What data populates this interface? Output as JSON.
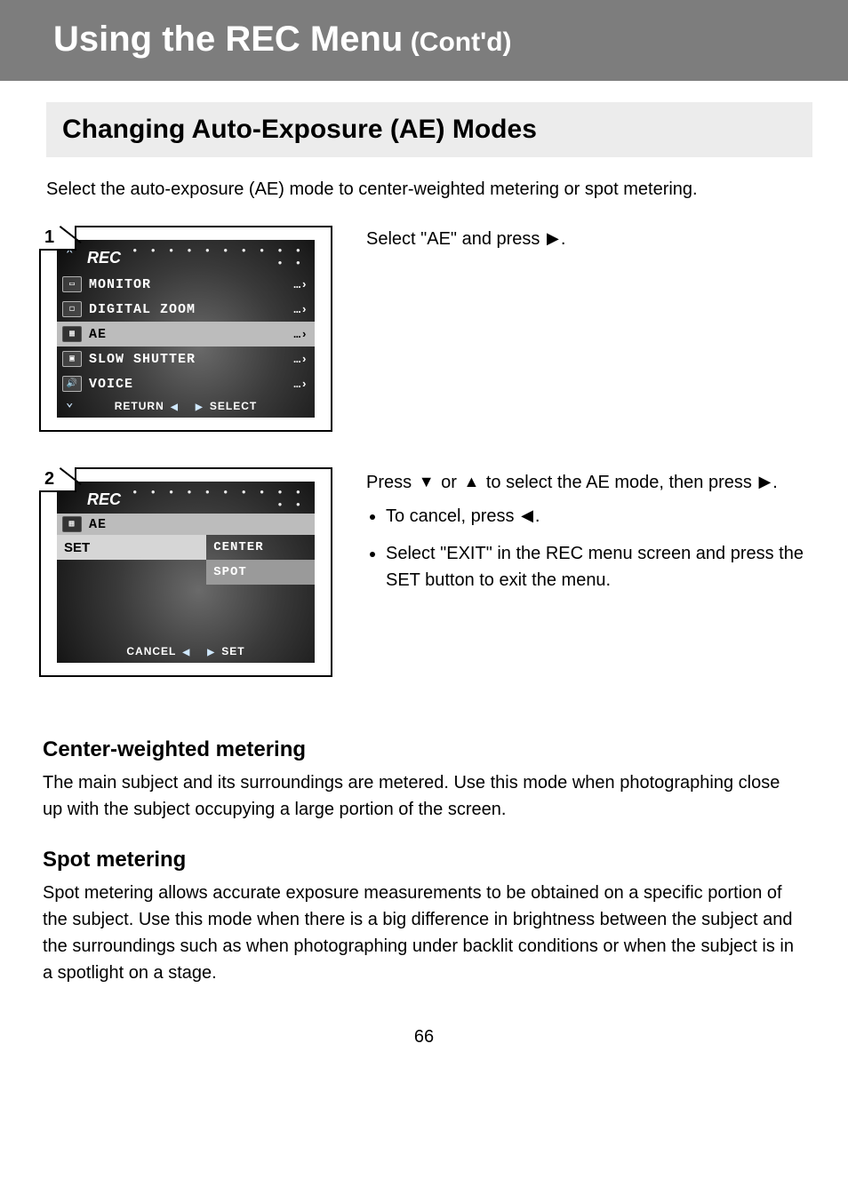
{
  "banner": {
    "title_main": "Using the REC Menu",
    "title_sub": "(Cont'd)"
  },
  "section_heading": "Changing Auto-Exposure (AE) Modes",
  "intro": "Select the auto-exposure (AE) mode to center-weighted metering or spot metering.",
  "shot1": {
    "number": "1",
    "header_label": "REC",
    "header_dots": "• • • • • • • • • • • •",
    "rows": [
      {
        "icon_name": "monitor-icon",
        "label": "MONITOR",
        "more": "…›"
      },
      {
        "icon_name": "zoom-icon",
        "label": "DIGITAL ZOOM",
        "more": "…›"
      },
      {
        "icon_name": "ae-icon",
        "label": "AE",
        "more": "…›",
        "highlight": true
      },
      {
        "icon_name": "shutter-icon",
        "label": "SLOW SHUTTER",
        "more": "…›"
      },
      {
        "icon_name": "voice-icon",
        "label": "VOICE",
        "more": "…›"
      }
    ],
    "footer_left": "RETURN",
    "footer_right": "SELECT"
  },
  "shot2": {
    "number": "2",
    "header_label": "REC",
    "header_dots": "• • • • • • • • • • • •",
    "sub_label": "AE",
    "left_cell": "SET",
    "options": [
      "CENTER",
      "SPOT"
    ],
    "footer_left": "CANCEL",
    "footer_right": "SET"
  },
  "step1": {
    "prefix": "Select \"AE\" and press",
    "suffix": "."
  },
  "step2": {
    "line1a": "Press",
    "line1b": "or",
    "line1c": "to select the AE mode, then press",
    "line1d": ".",
    "note1a": "To cancel, press",
    "note1b": ".",
    "note2": "Select \"EXIT\" in the REC menu screen and press the SET button to exit the menu."
  },
  "meter": {
    "center_title": "Center-weighted metering",
    "center_body": "The main subject and its surroundings are metered. Use this mode when photographing close up with the subject occupying a large portion of the screen.",
    "spot_title": "Spot metering",
    "spot_body": "Spot metering allows accurate exposure measurements to be obtained on a specific portion of the subject. Use this mode when there is a big difference in brightness between the subject and the surroundings such as when photographing under backlit conditions or when the subject is in a spotlight on a stage."
  },
  "page_number": "66"
}
